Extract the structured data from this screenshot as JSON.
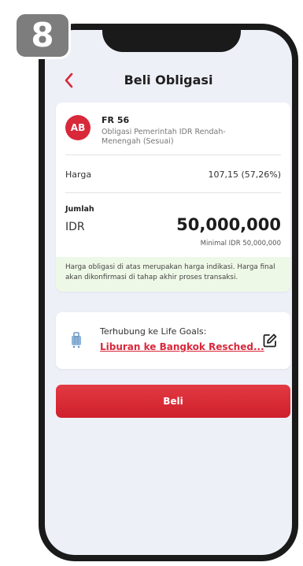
{
  "step_badge": "8",
  "header": {
    "title": "Beli Obligasi",
    "back_icon": "chevron-left-icon"
  },
  "bond": {
    "avatar_text": "AB",
    "code": "FR 56",
    "description": "Obligasi Pemerintah IDR Rendah-Menengah (Sesuai)",
    "price_label": "Harga",
    "price_value": "107,15 (57,26%)",
    "amount_label": "Jumlah",
    "currency": "IDR",
    "amount_value": "50,000,000",
    "minimum_note": "Minimal IDR 50,000,000",
    "info_text": "Harga obligasi di atas merupakan harga indikasi. Harga final akan dikonfirmasi di tahap akhir proses transaksi."
  },
  "life_goal": {
    "label": "Terhubung ke Life Goals:",
    "goal_name": "Liburan ke Bangkok Resched...",
    "icon": "luggage-icon",
    "edit_icon": "edit-icon"
  },
  "buy_button_label": "Beli",
  "colors": {
    "accent": "#d8283a",
    "background": "#eef0f8",
    "info_background": "#eef8e6",
    "frame": "#1a1a1a"
  }
}
